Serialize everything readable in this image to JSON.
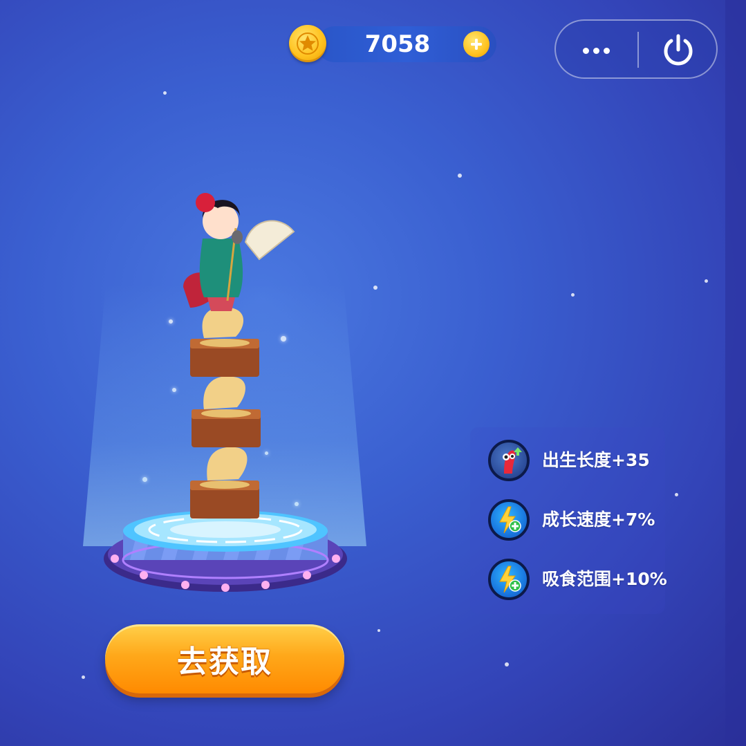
{
  "currency": {
    "amount": "7058",
    "icon": "gold-coin-star-icon",
    "add_icon": "plus-icon"
  },
  "capsule_menu": {
    "more_icon": "more-dots-icon",
    "close_icon": "power-icon"
  },
  "skin": {
    "character": "dancer with fan on three gramophones",
    "platform": "display-pedestal"
  },
  "buffs": [
    {
      "label": "出生长度+35",
      "icon": "worm-length-icon"
    },
    {
      "label": "成长速度+7%",
      "icon": "lightning-plus-icon"
    },
    {
      "label": "吸食范围+10%",
      "icon": "lightning-plus-icon"
    }
  ],
  "cta": {
    "label": "去获取"
  },
  "colors": {
    "background": "#3a5fd0",
    "button": "#ffa81a",
    "coin": "#ffc21f",
    "buff_icon": "#1a78e0"
  }
}
